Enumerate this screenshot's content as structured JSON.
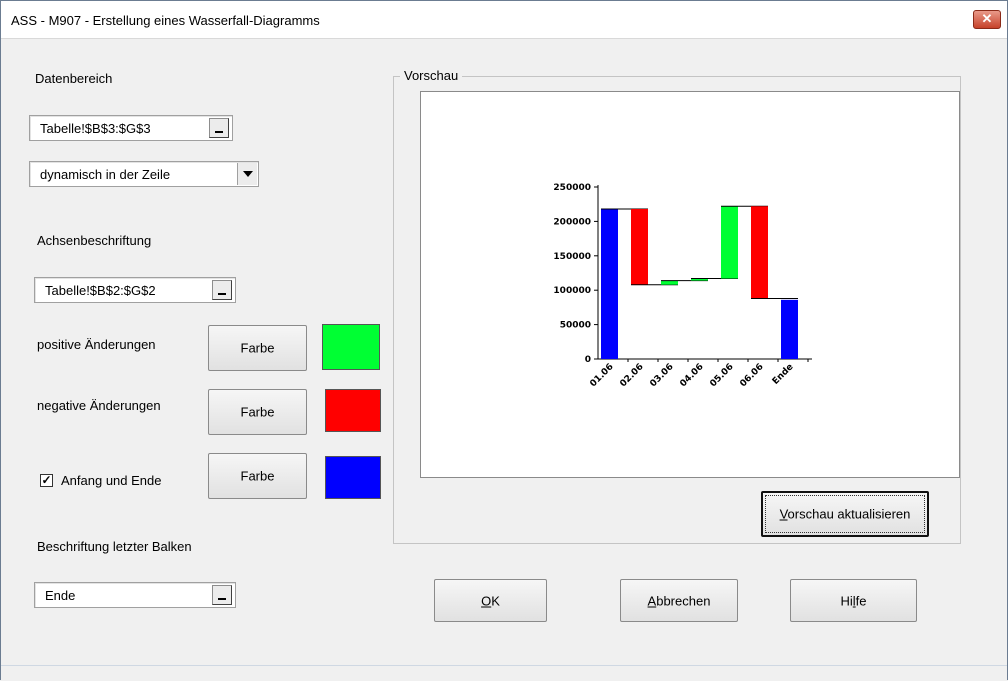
{
  "window": {
    "title": "ASS - M907 - Erstellung eines Wasserfall-Diagramms",
    "close_glyph": "✕"
  },
  "datenbereich": {
    "label": "Datenbereich",
    "range_value": "Tabelle!$B$3:$G$3",
    "mode_value": "dynamisch in der Zeile"
  },
  "achsen": {
    "label": "Achsenbeschriftung",
    "range_value": "Tabelle!$B$2:$G$2"
  },
  "colors": {
    "positive_label": "positive Änderungen",
    "negative_label": "negative Änderungen",
    "anfang_ende_label": "Anfang und Ende",
    "anfang_ende_checked": true,
    "check_glyph": "✓",
    "button_label": "Farbe",
    "positive_color": "#00ff33",
    "negative_color": "#ff0000",
    "anfang_ende_color": "#0000ff"
  },
  "letzter_balken": {
    "label": "Beschriftung letzter Balken",
    "value": "Ende"
  },
  "preview": {
    "legend": "Vorschau",
    "refresh_button_mnemonic": "V",
    "refresh_button_rest": "orschau aktualisieren"
  },
  "buttons": {
    "ok_mnemonic": "O",
    "ok_rest": "K",
    "cancel_mnemonic": "A",
    "cancel_rest": "bbrechen",
    "help_pre": "Hi",
    "help_mnemonic": "l",
    "help_post": "fe"
  },
  "chart_data": {
    "type": "bar",
    "subtype": "waterfall",
    "categories": [
      "01.06",
      "02.06",
      "03.06",
      "04.06",
      "05.06",
      "06.06",
      "Ende"
    ],
    "ylim": [
      0,
      250000
    ],
    "yticks": [
      "0",
      "50000",
      "100000",
      "150000",
      "200000",
      "250000"
    ],
    "ytick_values": [
      0,
      50000,
      100000,
      150000,
      200000,
      250000
    ],
    "bars": [
      {
        "category": "01.06",
        "start": 0,
        "end": 218000,
        "kind": "total"
      },
      {
        "category": "02.06",
        "start": 218000,
        "end": 108000,
        "kind": "negative"
      },
      {
        "category": "03.06",
        "start": 108000,
        "end": 114000,
        "kind": "positive"
      },
      {
        "category": "04.06",
        "start": 114000,
        "end": 117000,
        "kind": "positive"
      },
      {
        "category": "05.06",
        "start": 117000,
        "end": 222000,
        "kind": "positive"
      },
      {
        "category": "06.06",
        "start": 222000,
        "end": 88000,
        "kind": "negative"
      },
      {
        "category": "Ende",
        "start": 0,
        "end": 86000,
        "kind": "total"
      }
    ],
    "grid": false,
    "legend": "none"
  }
}
